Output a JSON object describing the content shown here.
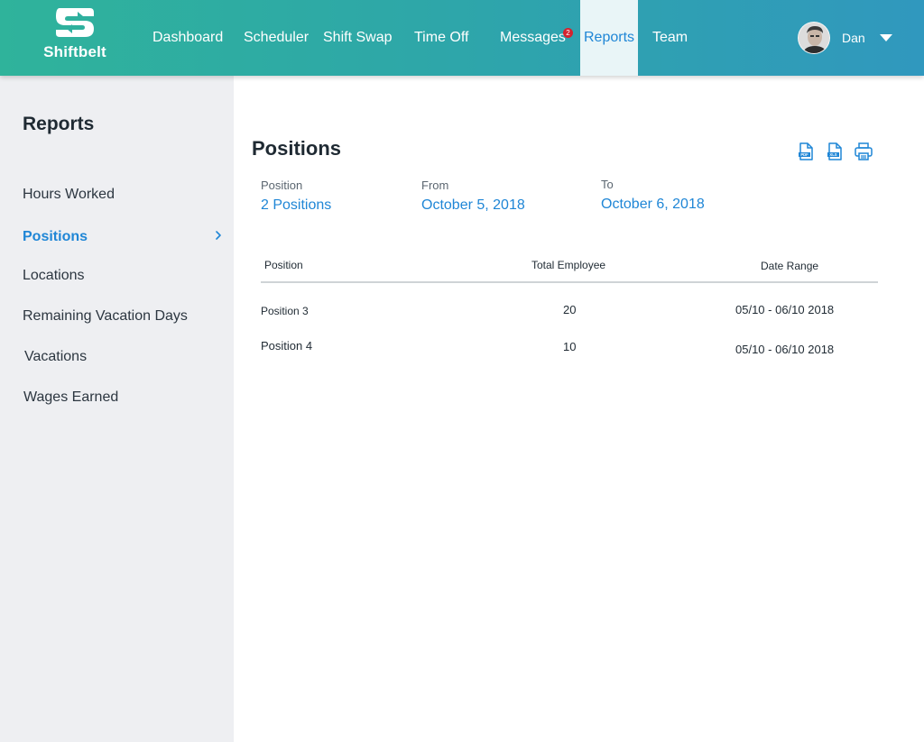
{
  "brand": {
    "name": "Shiftbelt"
  },
  "nav": {
    "items": [
      {
        "label": "Dashboard"
      },
      {
        "label": "Scheduler"
      },
      {
        "label": "Shift Swap"
      },
      {
        "label": "Time Off"
      },
      {
        "label": "Messages",
        "badge": "2"
      },
      {
        "label": "Reports",
        "active": true
      },
      {
        "label": "Team"
      }
    ]
  },
  "user": {
    "name": "Dan",
    "avatar_icon": "avatar-photo",
    "menu_icon": "caret-down-icon"
  },
  "sidebar": {
    "title": "Reports",
    "items": [
      {
        "label": "Hours Worked"
      },
      {
        "label": "Positions",
        "active": true,
        "icon": "chevron-right-icon"
      },
      {
        "label": "Locations"
      },
      {
        "label": "Remaining Vacation Days"
      },
      {
        "label": "Vacations"
      },
      {
        "label": "Wages Earned"
      }
    ]
  },
  "report": {
    "title": "Positions",
    "export_icons": [
      "pdf-icon",
      "xls-icon",
      "print-icon"
    ],
    "filters": {
      "position": {
        "label": "Position",
        "value": "2 Positions"
      },
      "from": {
        "label": "From",
        "value": "October 5, 2018"
      },
      "to": {
        "label": "To",
        "value": "October 6, 2018"
      }
    },
    "table": {
      "columns": [
        "Position",
        "Total Employee",
        "Date Range"
      ],
      "rows": [
        [
          "Position 3",
          "20",
          "05/10 - 06/10 2018"
        ],
        [
          "Position 4",
          "10",
          "05/10 - 06/10 2018"
        ]
      ]
    }
  },
  "colors": {
    "header_gradient_start": "#2fb39b",
    "header_gradient_end": "#3098be",
    "accent": "#1f86d6",
    "sidebar_bg": "#eeeff2",
    "badge": "#d4232f"
  }
}
